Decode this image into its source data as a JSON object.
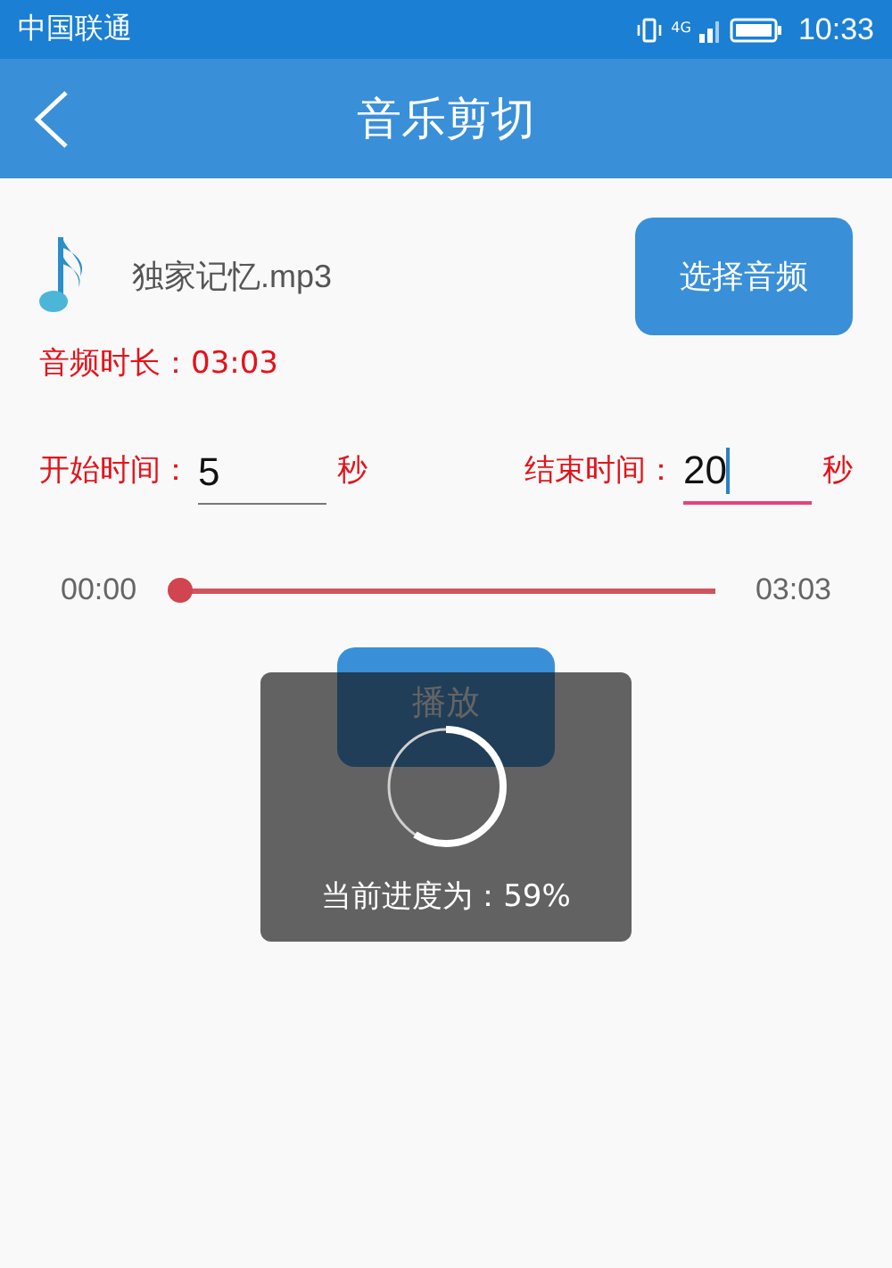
{
  "status_bar": {
    "carrier": "中国联通",
    "network": "4G",
    "time": "10:33"
  },
  "app_bar": {
    "title": "音乐剪切"
  },
  "file": {
    "name": "独家记忆.mp3",
    "button": "选择音频"
  },
  "duration": {
    "label": "音频时长：",
    "value": "03:03"
  },
  "time_fields": [
    {
      "label": "开始时间：",
      "value": "5",
      "unit": "秒",
      "focused": false
    },
    {
      "label": "结束时间：",
      "value": "20",
      "unit": "秒",
      "focused": true
    }
  ],
  "slider": {
    "start": "00:00",
    "end": "03:03",
    "level": 0
  },
  "play_button": "播放",
  "progress_dialog": {
    "text": "当前进度为：59%"
  }
}
